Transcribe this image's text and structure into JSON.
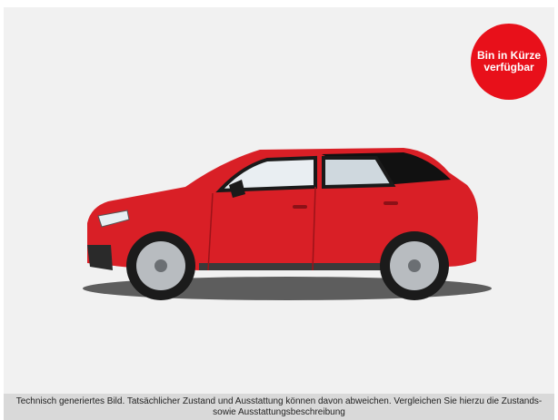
{
  "colors": {
    "badge": "#e8101a",
    "car_body": "#d91f26",
    "background": "#f1f1f1",
    "disclaimer_bar": "#d9d9d9"
  },
  "badge": {
    "label": "Bin in Kürze verfügbar"
  },
  "disclaimer": {
    "text": "Technisch generiertes Bild. Tatsächlicher Zustand und Ausstattung können davon abweichen. Vergleichen Sie hierzu die Zustands-sowie Ausstattungsbeschreibung"
  }
}
